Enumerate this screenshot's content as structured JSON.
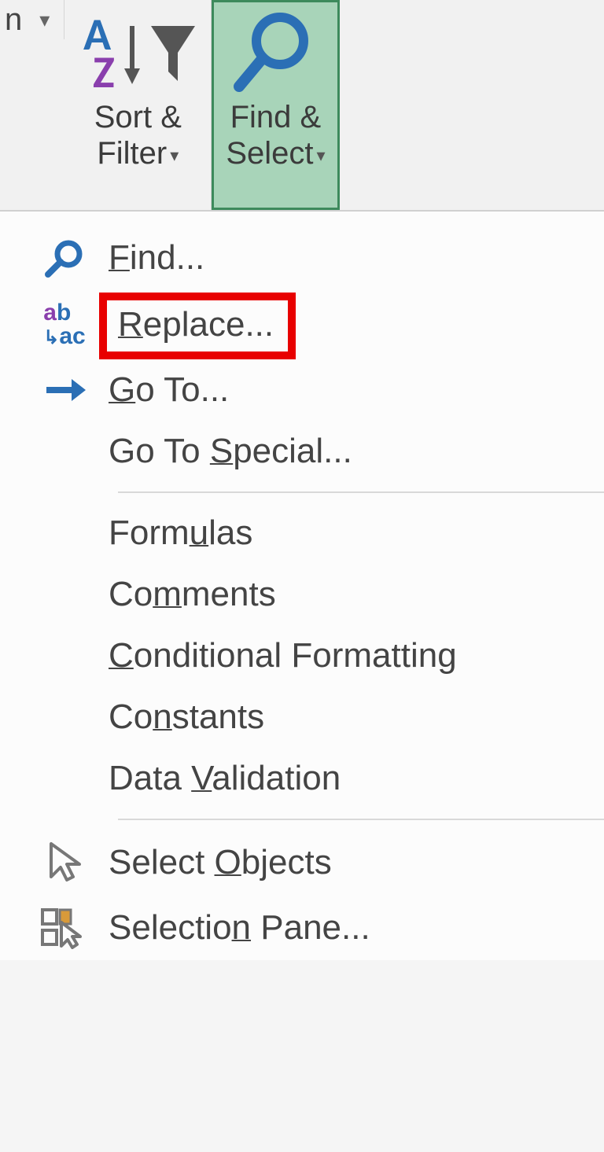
{
  "ribbon": {
    "sort_filter": {
      "line1": "Sort &",
      "line2": "Filter"
    },
    "find_select": {
      "line1": "Find &",
      "line2": "Select"
    }
  },
  "menu": {
    "find": "Find...",
    "replace": "Replace...",
    "goto": "Go To...",
    "goto_special": "Go To Special...",
    "formulas": "Formulas",
    "comments": "Comments",
    "cond_fmt": "Conditional Formatting",
    "constants": "Constants",
    "data_val": "Data Validation",
    "sel_objects": "Select Objects",
    "sel_pane": "Selection Pane..."
  }
}
